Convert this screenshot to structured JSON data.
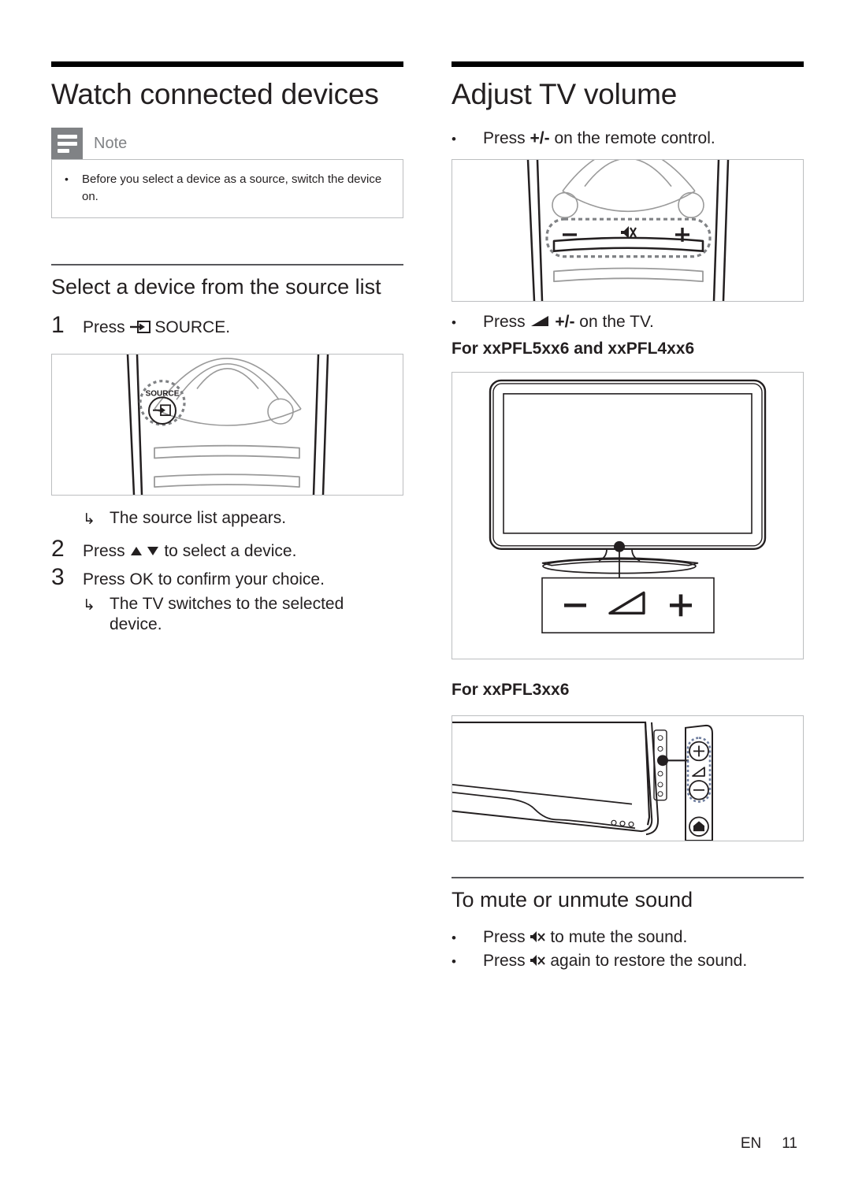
{
  "document": {
    "language_code": "EN",
    "page_number": "11"
  },
  "left_column": {
    "chapter_title": "Watch connected devices",
    "note": {
      "label": "Note",
      "icon": "note-lines-icon",
      "items": [
        "Before you select a device as a source, switch the device on."
      ]
    },
    "section_title": "Select a device from the source list",
    "steps": [
      {
        "number": "1",
        "text_before_icon": "Press ",
        "icon": "source-input-icon",
        "text_after_icon": " SOURCE."
      },
      {
        "number": "2",
        "text_before_icon": "Press ",
        "icon": "up-down-arrows-icon",
        "text_after_icon": " to select a device."
      },
      {
        "number": "3",
        "text_before_icon": "Press ",
        "icon": "",
        "text_after_icon": "OK to confirm your choice."
      }
    ],
    "results": [
      {
        "arrow": "↳",
        "text": "The source list appears."
      },
      {
        "arrow": "↳",
        "text": "The TV switches to the selected device."
      }
    ],
    "figure_remote_source": {
      "name": "remote-control-source-button-figure",
      "button_label": "SOURCE"
    }
  },
  "right_column": {
    "chapter_title": "Adjust TV volume",
    "bullets": [
      {
        "text_before_icon": "Press ",
        "icon": "",
        "bold_text": "+/-",
        "text_after_icon": " on the remote control."
      },
      {
        "text_before_icon": "Press ",
        "icon": "volume-wedge-icon",
        "bold_text": "+/-",
        "text_after_icon": " on the TV."
      }
    ],
    "figure_remote_volume": {
      "name": "remote-control-volume-rocker-figure",
      "minus": "−",
      "mute": "mute-speaker-icon",
      "plus": "+"
    },
    "model_heading_1": "For xxPFL5xx6 and xxPFL4xx6",
    "figure_tv_front": {
      "name": "tv-front-volume-controls-figure",
      "callout_minus": "−",
      "callout_wedge": "volume-wedge-icon",
      "callout_plus": "+"
    },
    "model_heading_2": "For xxPFL3xx6",
    "figure_tv_side": {
      "name": "tv-side-volume-controls-figure",
      "plus": "+",
      "wedge": "volume-wedge-icon",
      "minus": "−",
      "home": "home-icon"
    },
    "mute_section": {
      "title": "To mute or unmute sound",
      "bullets": [
        {
          "text_before_icon": "Press ",
          "icon": "mute-speaker-icon",
          "text_after_icon": " to mute the sound."
        },
        {
          "text_before_icon": "Press ",
          "icon": "mute-speaker-icon",
          "text_after_icon": " again to restore the sound."
        }
      ]
    }
  },
  "colors": {
    "text": "#231f20",
    "note_badge": "#808285",
    "note_border": "#bcbec0",
    "rule_heavy": "#000000",
    "rule_thin": "#58585b"
  }
}
